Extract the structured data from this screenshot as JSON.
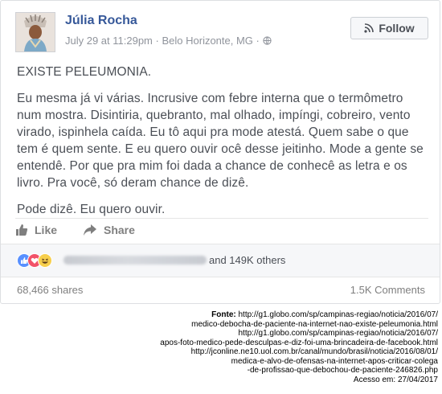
{
  "post": {
    "author": "Júlia Rocha",
    "date": "July 29 at 11:29pm",
    "separator": "·",
    "location": "Belo Horizonte, MG",
    "follow_label": "Follow",
    "paragraph1": "EXISTE PELEUMONIA.",
    "paragraph2": "Eu mesma já vi várias. Incrusive com febre interna que o termômetro num mostra. Disintiria, quebranto, mal olhado, impíngi, cobreiro, vento virado, ispinhela caída. Eu tô aqui pra mode atestá. Quem sabe o que tem é quem sente. E eu quero ouvir ocê desse jeitinho. Mode a gente se entendê. Por que pra mim foi dada a chance de conhecê as letra e os livro. Pra você, só deram chance de dizê.",
    "paragraph3": "Pode dizê. Eu quero ouvir.",
    "like_label": "Like",
    "share_label": "Share",
    "reactions_text": "and 149K others",
    "shares_count": "68,466 shares",
    "comments_count": "1.5K Comments",
    "colors": {
      "link_blue": "#365899",
      "text": "#4b4f56",
      "muted": "#90949c"
    }
  },
  "source": {
    "label": "Fonte:",
    "line1": "http://g1.globo.com/sp/campinas-regiao/noticia/2016/07/",
    "line2": "medico-debocha-de-paciente-na-internet-nao-existe-peleumonia.html",
    "line3": "http://g1.globo.com/sp/campinas-regiao/noticia/2016/07/",
    "line4": "apos-foto-medico-pede-desculpas-e-diz-foi-uma-brincadeira-de-facebook.html",
    "line5": "http://jconline.ne10.uol.com.br/canal/mundo/brasil/noticia/2016/08/01/",
    "line6": "medica-e-alvo-de-ofensas-na-internet-apos-criticar-colega",
    "line7": "-de-profissao-que-debochou-de-paciente-246826.php",
    "line8": "Acesso em: 27/04/2017"
  }
}
